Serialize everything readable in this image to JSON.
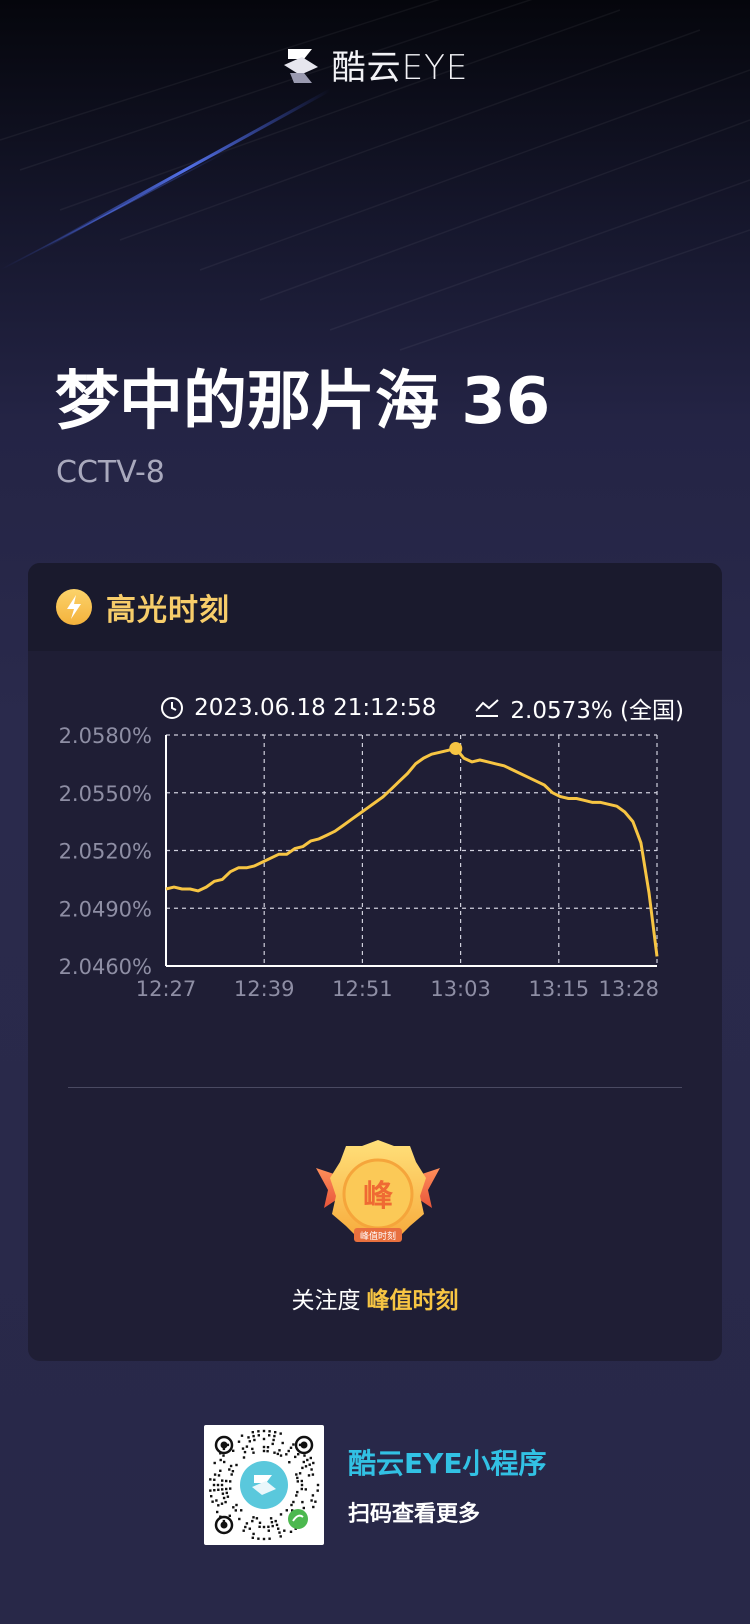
{
  "header": {
    "logo_text": "酷云EYE",
    "logo_icon": "kuyun-logo-icon"
  },
  "program": {
    "title": "梦中的那片海 36",
    "channel": "CCTV-8"
  },
  "card": {
    "title": "高光时刻",
    "title_icon": "lightning-icon",
    "timestamp": "2023.06.18 21:12:58",
    "rating": "2.0573% (全国)",
    "clock_icon": "clock-icon",
    "trend_icon": "trend-icon"
  },
  "chart_data": {
    "type": "line",
    "xlabel": "",
    "ylabel": "",
    "x_tick_labels": [
      "12:27",
      "12:39",
      "12:51",
      "13:03",
      "13:15",
      "13:28"
    ],
    "y_tick_labels": [
      "2.0580%",
      "2.0550%",
      "2.0520%",
      "2.0490%",
      "2.0460%"
    ],
    "ylim": [
      2.046,
      2.058
    ],
    "x_minutes_range": [
      "12:27",
      "13:28"
    ],
    "grid": true,
    "line_color": "#f7c543",
    "series": [
      {
        "x": [
          "12:27",
          "12:28",
          "12:29",
          "12:30",
          "12:31",
          "12:32",
          "12:33",
          "12:34",
          "12:35",
          "12:36",
          "12:37",
          "12:38",
          "12:39",
          "12:40",
          "12:41",
          "12:42",
          "12:43",
          "12:44",
          "12:45",
          "12:46",
          "12:47",
          "12:48",
          "12:49",
          "12:50",
          "12:51",
          "12:52",
          "12:53",
          "12:54",
          "12:55",
          "12:56",
          "12:57",
          "12:58",
          "12:59",
          "13:00",
          "13:01",
          "13:02",
          "13:03",
          "13:04",
          "13:05",
          "13:06",
          "13:07",
          "13:08",
          "13:09",
          "13:10",
          "13:11",
          "13:12",
          "13:13",
          "13:14",
          "13:15",
          "13:16",
          "13:17",
          "13:18",
          "13:19",
          "13:20",
          "13:21",
          "13:22",
          "13:23",
          "13:24",
          "13:25",
          "13:26",
          "13:27",
          "13:28"
        ],
        "values": [
          2.05,
          2.0501,
          2.05,
          2.05,
          2.0499,
          2.0501,
          2.0504,
          2.0505,
          2.0509,
          2.0511,
          2.0511,
          2.0512,
          2.0514,
          2.0516,
          2.0518,
          2.0518,
          2.0521,
          2.0522,
          2.0525,
          2.0526,
          2.0528,
          2.053,
          2.0533,
          2.0536,
          2.0539,
          2.0542,
          2.0545,
          2.0548,
          2.0552,
          2.0556,
          2.056,
          2.0565,
          2.0568,
          2.057,
          2.0571,
          2.0572,
          2.0573,
          2.0568,
          2.0566,
          2.0567,
          2.0566,
          2.0565,
          2.0564,
          2.0562,
          2.056,
          2.0558,
          2.0556,
          2.0554,
          2.055,
          2.0548,
          2.0547,
          2.0547,
          2.0546,
          2.0545,
          2.0545,
          2.0544,
          2.0543,
          2.054,
          2.0535,
          2.0524,
          2.0498,
          2.0465
        ],
        "peak_index": 36
      }
    ]
  },
  "attention": {
    "label": "关注度",
    "value": "峰值时刻",
    "medal_text": "峰",
    "medal_sub": "峰值时刻"
  },
  "promo": {
    "title": "酷云EYE小程序",
    "subtitle": "扫码查看更多",
    "qr_icon": "qr-code-icon"
  }
}
